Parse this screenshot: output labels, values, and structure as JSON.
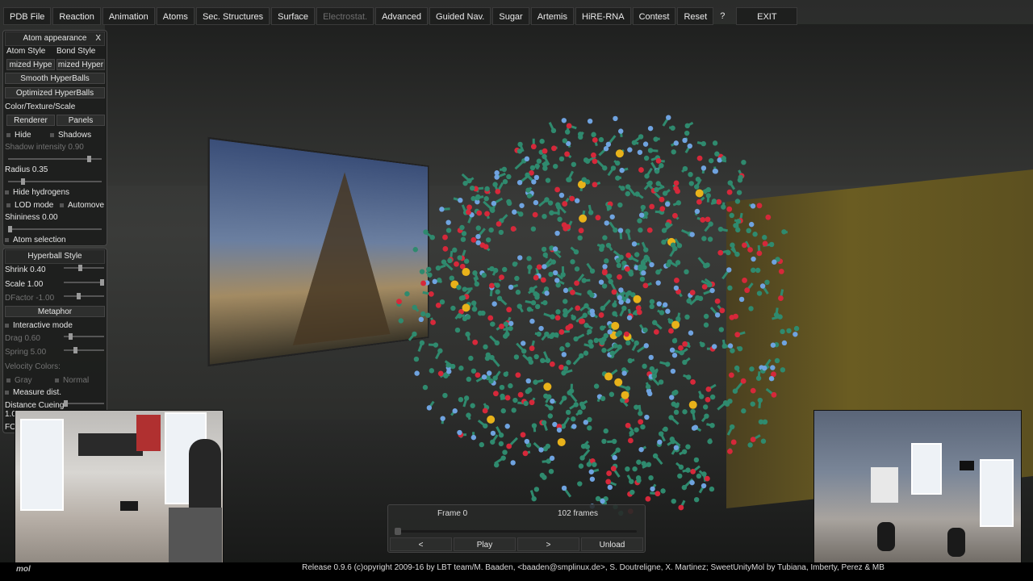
{
  "menu": {
    "items": [
      "PDB File",
      "Reaction",
      "Animation",
      "Atoms",
      "Sec. Structures",
      "Surface",
      "Electrostat.",
      "Advanced",
      "Guided Nav.",
      "Sugar",
      "Artemis",
      "HiRE-RNA",
      "Contest",
      "Reset"
    ],
    "disabled_item": "Electrostat.",
    "help": "?",
    "exit": "EXIT"
  },
  "atom_panel": {
    "title": "Atom appearance",
    "close": "X",
    "atom_style_label": "Atom Style",
    "bond_style_label": "Bond Style",
    "atom_style_value": "mized Hype",
    "bond_style_value": "mized Hyper",
    "smooth_btn": "Smooth HyperBalls",
    "optimized_btn": "Optimized HyperBalls",
    "color_label": "Color/Texture/Scale",
    "renderer_btn": "Renderer",
    "panels_btn": "Panels",
    "hide_label": "Hide",
    "shadows_label": "Shadows",
    "shadow_intensity": "Shadow intensity 0.90",
    "radius": "Radius 0.35",
    "hide_hydrogens": "Hide hydrogens",
    "lod_mode": "LOD mode",
    "automove": "Automove",
    "shininess": "Shininess 0.00",
    "atom_selection": "Atom selection"
  },
  "hyperball_panel": {
    "title": "Hyperball Style",
    "shrink": "Shrink 0.40",
    "scale": "Scale 1.00",
    "dfactor": "DFactor -1.00",
    "metaphor_btn": "Metaphor",
    "interactive_mode": "Interactive mode",
    "drag": "Drag 0.60",
    "spring": "Spring 5.00",
    "velocity_colors": "Velocity Colors:",
    "gray": "Gray",
    "normal": "Normal",
    "measure_dist": "Measure dist.",
    "distance_cueing": "Distance Cueing",
    "distance_value": "1.0",
    "fo": "FO"
  },
  "playback": {
    "frame": "Frame 0",
    "frames_total": "102 frames",
    "prev": "<",
    "play": "Play",
    "next": ">",
    "unload": "Unload"
  },
  "footer": {
    "text": "Release 0.9.6 (c)opyright 2009-16 by LBT team/M. Baaden, <baaden@smplinux.de>, S. Doutreligne, X. Martinez; SweetUnityMol by Tubiana, Imberty, Perez & MB",
    "logo": "mol"
  },
  "colors": {
    "carbon": "#2f8a6e",
    "oxygen": "#d6283a",
    "nitrogen": "#6fa3e0",
    "sulfur": "#e8b21a"
  }
}
